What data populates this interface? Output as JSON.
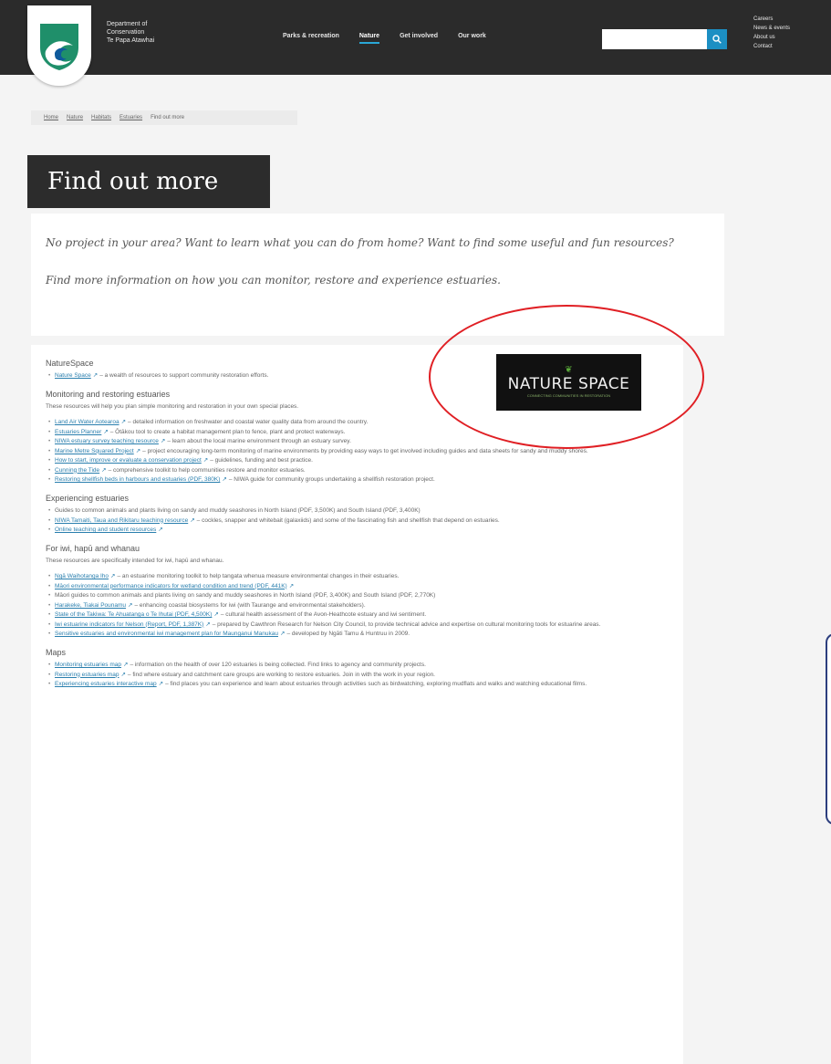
{
  "header": {
    "org_lines": [
      "Department of",
      "Conservation",
      "Te Papa Atawhai"
    ],
    "nav": [
      {
        "label": "Parks & recreation",
        "active": false
      },
      {
        "label": "Nature",
        "active": true
      },
      {
        "label": "Get involved",
        "active": false
      },
      {
        "label": "Our work",
        "active": false
      }
    ],
    "search_placeholder": "",
    "utility": [
      "Careers",
      "News & events",
      "About us",
      "Contact"
    ],
    "accent_color": "#2aa7d6"
  },
  "breadcrumb": [
    "Home",
    "Nature",
    "Habitats",
    "Estuaries",
    "Find out more"
  ],
  "page_title": "Find out more",
  "intro": {
    "p1": "No project in your area? Want to learn what you can do from home? Want to find some useful and fun resources?",
    "p2": "Find more information on how you can monitor, restore and experience estuaries."
  },
  "naturespace_logo": {
    "leaf": "❦",
    "word": "NATURE SPACE",
    "sub": "CONNECTING COMMUNITIES IN RESTORATION"
  },
  "sections": [
    {
      "heading": "NatureSpace",
      "lead": "",
      "items": [
        {
          "link": "Nature Space",
          "text": "– a wealth of resources to support community restoration efforts."
        }
      ]
    },
    {
      "heading": "Monitoring and restoring estuaries",
      "lead": "These resources will help you plan simple monitoring and restoration in your own special places.",
      "items": [
        {
          "link": "Land Air Water Aotearoa",
          "text": "– detailed information on freshwater and coastal water quality data from around the country."
        },
        {
          "link": "Estuaries Planner",
          "text": "– Ōtākou tool to create a habitat management plan to fence, plant and protect waterways."
        },
        {
          "link": "NIWA estuary survey teaching resource",
          "text": "– learn about the local marine environment through an estuary survey."
        },
        {
          "link": "Marine Metre Squared Project",
          "text": "– project encouraging long-term monitoring of marine environments by providing easy ways to get involved including guides and data sheets for sandy and muddy shores."
        },
        {
          "link": "How to start, improve or evaluate a conservation project",
          "text": "– guidelines, funding and best practice."
        },
        {
          "link": "Cunning the Tide",
          "text": "– comprehensive toolkit to help communities restore and monitor estuaries."
        },
        {
          "link": "Restoring shellfish beds in harbours and estuaries (PDF, 380K)",
          "text": "– NIWA guide for community groups undertaking a shellfish restoration project."
        }
      ]
    },
    {
      "heading": "Experiencing estuaries",
      "lead": "",
      "items": [
        {
          "link": "",
          "text": "Guides to common animals and plants living on sandy and muddy seashores in North Island (PDF, 3,500K) and South Island (PDF, 3,400K)"
        },
        {
          "link": "NIWA Tamaiti, Taua and Rikitaru teaching resource",
          "text": "– cockles, snapper and whitebait (galaxiids) and some of the fascinating fish and shellfish that depend on estuaries."
        },
        {
          "link": "Online teaching and student resources",
          "text": ""
        }
      ]
    },
    {
      "heading": "For iwi, hapū and whanau",
      "lead": "These resources are specifically intended for iwi, hapū and whanau.",
      "items": [
        {
          "link": "Ngā Waihotanga Iho",
          "text": "– an estuarine monitoring toolkit to help tangata whenua measure environmental changes in their estuaries."
        },
        {
          "link": "Māori environmental performance indicators for wetland condition and trend (PDF, 441K)",
          "text": ""
        },
        {
          "link": "",
          "text": "Māori guides to common animals and plants living on sandy and muddy seashores in North Island (PDF, 3,400K) and South Island (PDF, 2,770K)"
        },
        {
          "link": "Harakeke, Tiakai Pounamu",
          "text": "– enhancing coastal biosystems for iwi (with Taurange and environmental stakeholders)."
        },
        {
          "link": "State of the Takiwa: Te Ahuatanga o Te Ihutai (PDF, 4,500K)",
          "text": "– cultural health assessment of the Avon-Heathcote estuary and iwi sentiment."
        },
        {
          "link": "Iwi estuarine indicators for Nelson (Report, PDF, 1,387K)",
          "text": "– prepared by Cawthron Research for Nelson City Council, to provide technical advice and expertise on cultural monitoring tools for estuarine areas."
        },
        {
          "link": "Sensitive estuaries and environmental iwi management plan for Maunganui Manukau",
          "text": "– developed by Ngāti Tamu & Huntruu in 2009."
        }
      ]
    },
    {
      "heading": "Maps",
      "lead": "",
      "items": [
        {
          "link": "Monitoring estuaries map",
          "text": "– information on the health of over 120 estuaries is being collected. Find links to agency and community projects."
        },
        {
          "link": "Restoring estuaries map",
          "text": "– find where estuary and catchment care groups are working to restore estuaries. Join in with the work in your region."
        },
        {
          "link": "Experiencing estuaries interactive map",
          "text": "– find places you can experience and learn about estuaries through activities such as birdwatching, exploring mudflats and walks and watching educational films."
        }
      ]
    }
  ]
}
